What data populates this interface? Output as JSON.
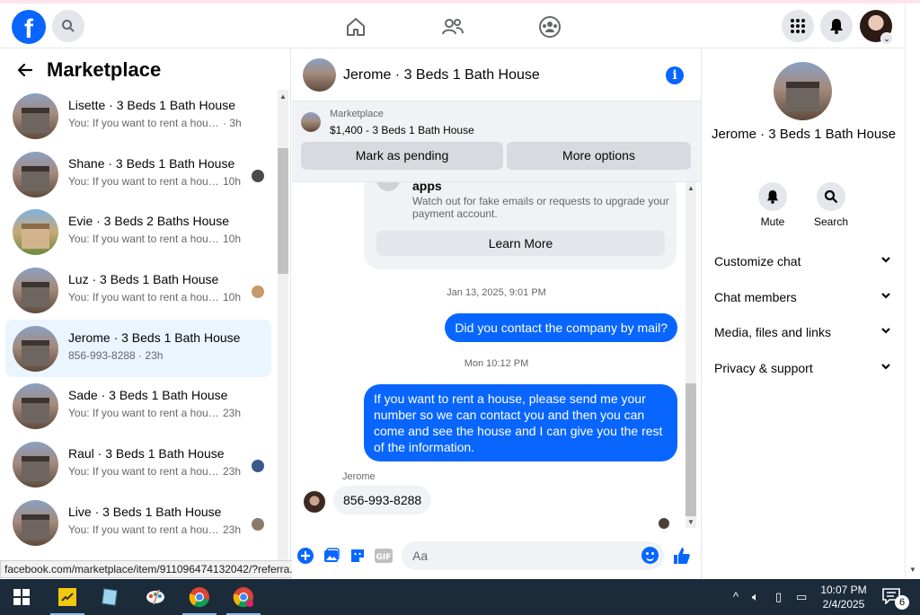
{
  "browser": {
    "status_url": "facebook.com/marketplace/item/911096474132042/?referra..."
  },
  "topbar": {
    "logo": "f",
    "avatar_badge": "⌄"
  },
  "sidebar": {
    "title": "Marketplace",
    "conversations": [
      {
        "title": "Lisette · 3 Beds 1 Bath House",
        "preview": "You: If you want to rent a house, pl...",
        "time": "· 3h"
      },
      {
        "title": "Shane · 3 Beds 1 Bath House",
        "preview": "You: If you want to rent a hous...",
        "time": "10h"
      },
      {
        "title": "Evie · 3 Beds 2 Baths House",
        "preview": "You: If you want to rent a house, ...",
        "time": "10h"
      },
      {
        "title": "Luz · 3 Beds 1 Bath House",
        "preview": "You: If you want to rent a hous...",
        "time": "10h"
      },
      {
        "title": "Jerome · 3 Beds 1 Bath House",
        "preview": "856-993-8288 · 23h",
        "time": ""
      },
      {
        "title": "Sade · 3 Beds 1 Bath House",
        "preview": "You: If you want to rent a house, ...",
        "time": "23h"
      },
      {
        "title": "Raul · 3 Beds 1 Bath House",
        "preview": "You: If you want to rent a hous...",
        "time": "23h"
      },
      {
        "title": "Live · 3 Beds 1 Bath House",
        "preview": "You: If you want to rent a hous...",
        "time": "23h"
      }
    ]
  },
  "chat": {
    "header_name": "Jerome · 3 Beds 1 Bath House",
    "listing": {
      "label": "Marketplace",
      "value": "$1,400 - 3 Beds 1 Bath House",
      "pending_button": "Mark as pending",
      "options_button": "More options"
    },
    "security_card": {
      "title": "apps",
      "text": "Watch out for fake emails or requests to upgrade your payment account.",
      "button": "Learn More"
    },
    "timestamp1": "Jan 13, 2025, 9:01 PM",
    "msg1": "Did you contact the company by mail?",
    "timestamp2": "Mon 10:12 PM",
    "msg2": "If you want to rent a house, please send me your number so we can contact you and then you can come and see the house and I can give you the rest of the information.",
    "sender": "Jerome",
    "reply": "856-993-8288",
    "composer_placeholder": "Aa",
    "gif_label": "GIF"
  },
  "details": {
    "name": "Jerome · 3 Beds 1 Bath House",
    "mute_label": "Mute",
    "search_label": "Search",
    "sections": [
      "Customize chat",
      "Chat members",
      "Media, files and links",
      "Privacy & support"
    ]
  },
  "taskbar": {
    "time": "10:07 PM",
    "date": "2/4/2025",
    "notifications": "6"
  }
}
